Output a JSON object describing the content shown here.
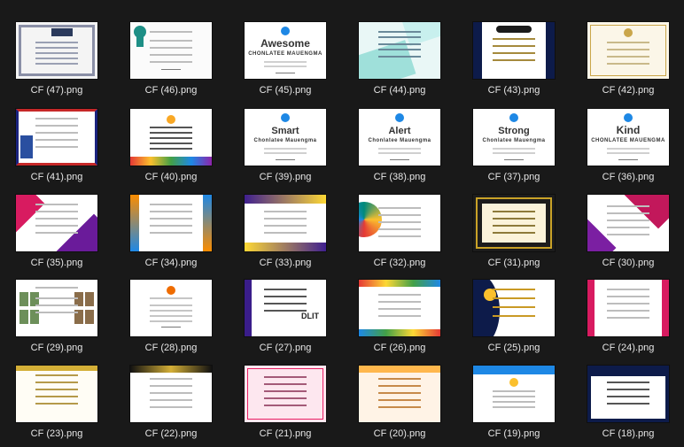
{
  "files": [
    {
      "name": "CF (47).png",
      "theme": "kst"
    },
    {
      "name": "CF (46).png",
      "theme": "ribbon"
    },
    {
      "name": "CF (45).png",
      "theme": "word",
      "word": "Awesome",
      "person": "CHONLATEE MAUENGMA",
      "style": "upper"
    },
    {
      "name": "CF (44).png",
      "theme": "cyan"
    },
    {
      "name": "CF (43).png",
      "theme": "navygold"
    },
    {
      "name": "CF (42).png",
      "theme": "cream"
    },
    {
      "name": "CF (41).png",
      "theme": "flag"
    },
    {
      "name": "CF (40).png",
      "theme": "colorband"
    },
    {
      "name": "CF (39).png",
      "theme": "word",
      "word": "Smart",
      "person": "Chonlatee Mauengma",
      "style": "mixed"
    },
    {
      "name": "CF (38).png",
      "theme": "word",
      "word": "Alert",
      "person": "Chonlatee Mauengma",
      "style": "mixed"
    },
    {
      "name": "CF (37).png",
      "theme": "word",
      "word": "Strong",
      "person": "Chonlatee Mauengma",
      "style": "mixed"
    },
    {
      "name": "CF (36).png",
      "theme": "word",
      "word": "Kind",
      "person": "CHONLATEE MAUENGMA",
      "style": "upper"
    },
    {
      "name": "CF (35).png",
      "theme": "pinkpurple"
    },
    {
      "name": "CF (34).png",
      "theme": "orangeblue"
    },
    {
      "name": "CF (33).png",
      "theme": "purpleyellow"
    },
    {
      "name": "CF (32).png",
      "theme": "tealcircle"
    },
    {
      "name": "CF (31).png",
      "theme": "darkgold"
    },
    {
      "name": "CF (30).png",
      "theme": "magenta"
    },
    {
      "name": "CF (29).png",
      "theme": "photos"
    },
    {
      "name": "CF (28).png",
      "theme": "plain"
    },
    {
      "name": "CF (27).png",
      "theme": "dlit",
      "logo": "DLIT"
    },
    {
      "name": "CF (26).png",
      "theme": "colorful"
    },
    {
      "name": "CF (25).png",
      "theme": "navycurve"
    },
    {
      "name": "CF (24).png",
      "theme": "pinkwhite"
    },
    {
      "name": "CF (23).png",
      "theme": "goldleaf"
    },
    {
      "name": "CF (22).png",
      "theme": "goldblack"
    },
    {
      "name": "CF (21).png",
      "theme": "pinkpattern"
    },
    {
      "name": "CF (20).png",
      "theme": "peach"
    },
    {
      "name": "CF (19).png",
      "theme": "bluebar"
    },
    {
      "name": "CF (18).png",
      "theme": "navyframe"
    }
  ]
}
